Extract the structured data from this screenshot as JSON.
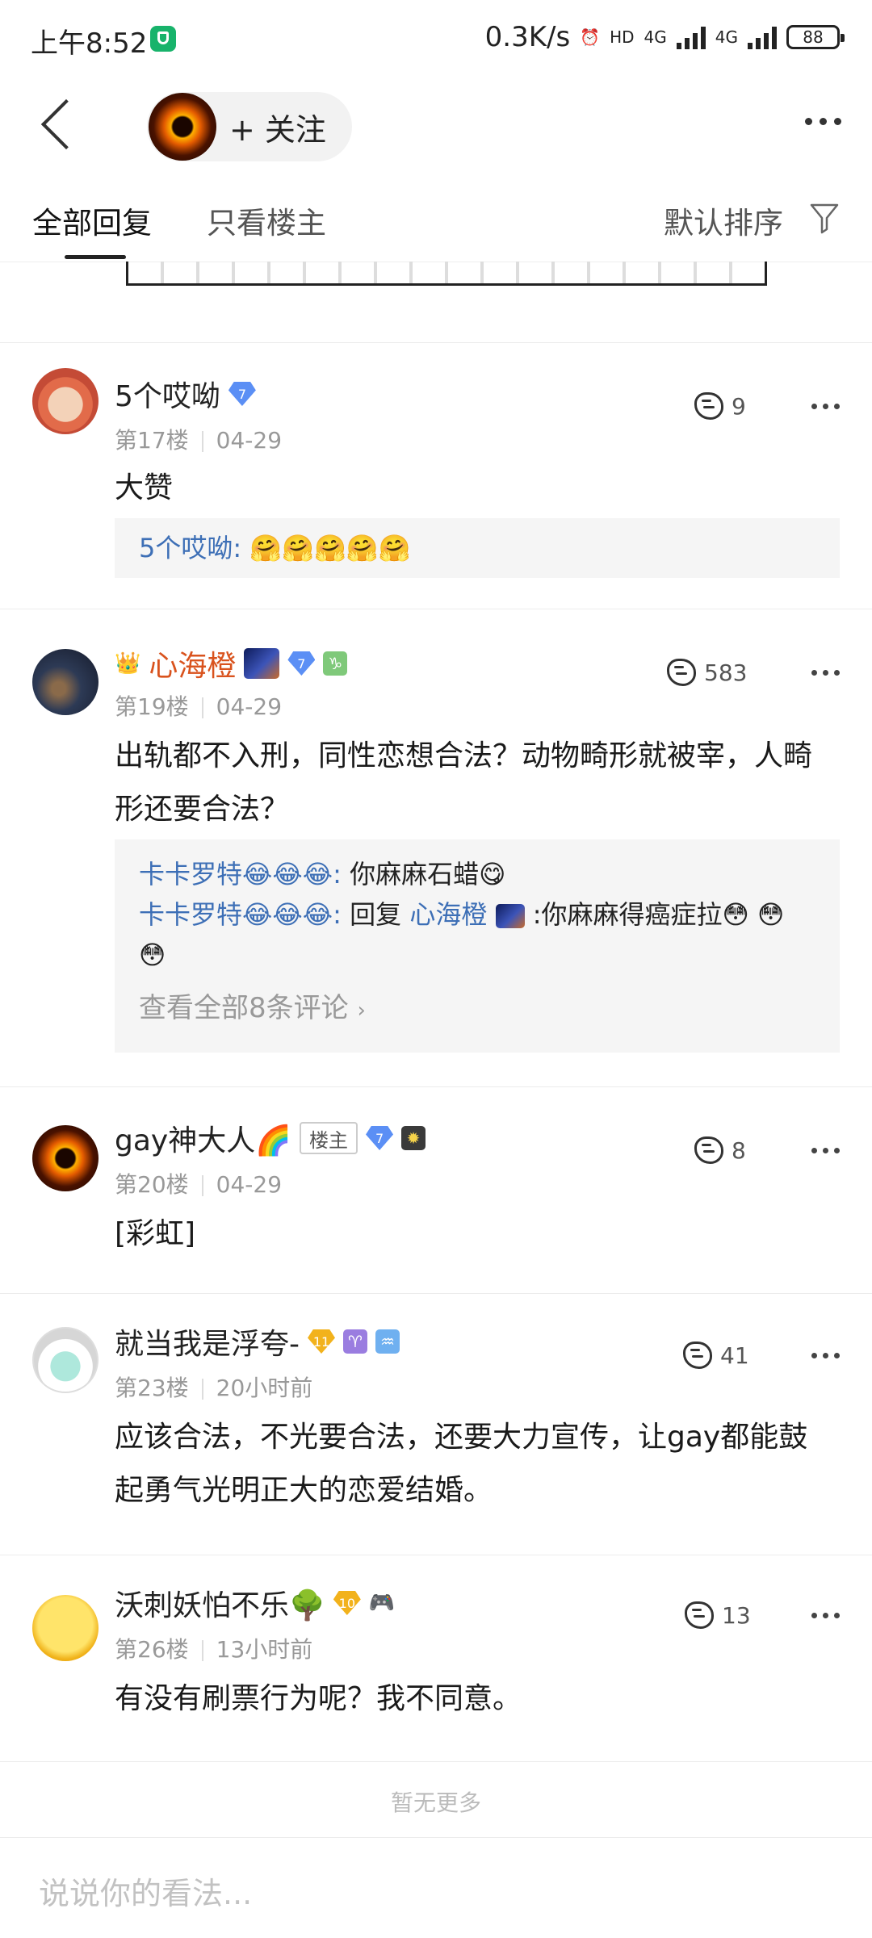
{
  "status_bar": {
    "time": "上午8:52",
    "net_speed": "0.3K/s",
    "net1": "4G",
    "net2": "4G",
    "battery": "88"
  },
  "header": {
    "follow_label": "+ 关注",
    "icons": [
      "back-arrow-icon",
      "more-icon"
    ]
  },
  "tabs": {
    "all": "全部回复",
    "op_only": "只看楼主",
    "sort": "默认排序"
  },
  "posts": [
    {
      "name": "5个哎呦",
      "level": "7",
      "floor": "第17楼",
      "time": "04-29",
      "likes": "9",
      "content": "大赞",
      "replies": [
        {
          "name": "5个哎呦:",
          "text": "🤗🤗🤗🤗🤗"
        }
      ]
    },
    {
      "name": "心海橙",
      "level": "7",
      "floor": "第19楼",
      "time": "04-29",
      "likes": "583",
      "content": "出轨都不入刑，同性恋想合法？动物畸形就被宰，人畸形还要合法？",
      "replies": [
        {
          "name": "卡卡罗特😂😂😂:",
          "text": "你麻麻石蜡😋"
        },
        {
          "name": "卡卡罗特😂😂😂:",
          "reply_word": "回复",
          "reply_to": "心海橙",
          "text": ":你麻麻得癌症拉😳 😳 😳"
        }
      ],
      "view_all": "查看全部8条评论"
    },
    {
      "name": "gay神大人🌈",
      "tag": "楼主",
      "level": "7",
      "floor": "第20楼",
      "time": "04-29",
      "likes": "8",
      "content": "[彩虹]"
    },
    {
      "name": "就当我是浮夸-",
      "level": "11",
      "floor": "第23楼",
      "time": "20小时前",
      "likes": "41",
      "content": "应该合法，不光要合法，还要大力宣传，让gay都能鼓起勇气光明正大的恋爱结婚。"
    },
    {
      "name": "沃刺妖怕不乐🌳",
      "level": "10",
      "floor": "第26楼",
      "time": "13小时前",
      "likes": "13",
      "content": "有没有刷票行为呢？我不同意。"
    }
  ],
  "footer": {
    "no_more": "暂无更多",
    "input_placeholder": "说说你的看法..."
  },
  "colors": {
    "accent_link": "#3d6fb6",
    "op_name": "#d9531e",
    "level_badge": "#5b8ff5",
    "gold_badge": "#f2b21c"
  }
}
